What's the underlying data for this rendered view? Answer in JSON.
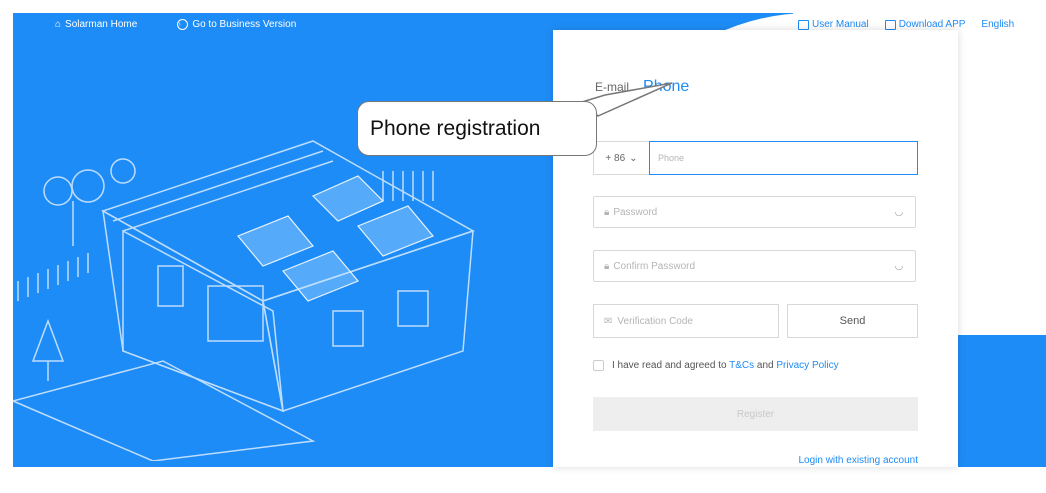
{
  "topbar": {
    "home_label": "Solarman Home",
    "business_label": "Go to Business Version",
    "manual_label": "User Manual",
    "download_label": "Download APP",
    "language_label": "English"
  },
  "form": {
    "tab_email": "E-mail",
    "tab_phone": "Phone",
    "country_code": "+ 86",
    "phone_placeholder": "Phone",
    "password_placeholder": "Password",
    "confirm_placeholder": "Confirm Password",
    "verification_placeholder": "Verification Code",
    "send_label": "Send",
    "agree_prefix": "I have read and agreed to",
    "tcs_label": "T&Cs",
    "and_label": "and",
    "privacy_label": "Privacy Policy",
    "register_label": "Register",
    "login_label": "Login with existing account"
  },
  "callout": {
    "text": "Phone registration"
  },
  "colors": {
    "accent": "#1e8cf6"
  }
}
